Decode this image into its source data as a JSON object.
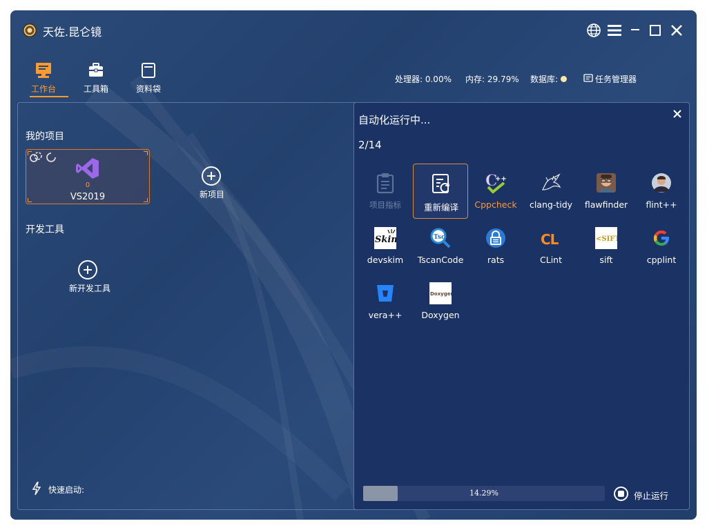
{
  "app": {
    "title": "天佐.昆仑镜"
  },
  "nav": {
    "tabs": [
      {
        "label": "工作台",
        "icon": "monitor-icon",
        "active": true
      },
      {
        "label": "工具箱",
        "icon": "toolbox-icon",
        "active": false
      },
      {
        "label": "资料袋",
        "icon": "folder-bag-icon",
        "active": false
      }
    ]
  },
  "status": {
    "cpu": "处理器: 0.00%",
    "memory": "内存: 29.79%",
    "database": "数据库:",
    "database_status_color": "#ffe9a8",
    "task_manager": "任务管理器"
  },
  "left": {
    "projects_title": "我的项目",
    "project": {
      "name": "VS2019",
      "count": "0"
    },
    "new_project": "新项目",
    "devtools_title": "开发工具",
    "new_devtool": "新开发工具",
    "quick_launch": "快速启动:"
  },
  "automation": {
    "title": "自动化运行中...",
    "counter": "2/14",
    "tools": [
      {
        "label": "项目指标",
        "icon": "clipboard-icon",
        "state": "disabled"
      },
      {
        "label": "重新编译",
        "icon": "recompile-icon",
        "state": "selected"
      },
      {
        "label": "Cppcheck",
        "icon": "cppcheck-icon",
        "state": "warn"
      },
      {
        "label": "clang-tidy",
        "icon": "dragon-icon",
        "state": "normal"
      },
      {
        "label": "flawfinder",
        "icon": "flawfinder-avatar-icon",
        "state": "normal"
      },
      {
        "label": "flint++",
        "icon": "flint-avatar-icon",
        "state": "normal"
      },
      {
        "label": "devskim",
        "icon": "devskim-icon",
        "state": "normal"
      },
      {
        "label": "TscanCode",
        "icon": "tscancode-icon",
        "state": "normal"
      },
      {
        "label": "rats",
        "icon": "rats-icon",
        "state": "normal"
      },
      {
        "label": "CLint",
        "icon": "clint-icon",
        "state": "normal"
      },
      {
        "label": "sift",
        "icon": "sift-icon",
        "state": "normal"
      },
      {
        "label": "cpplint",
        "icon": "google-icon",
        "state": "normal"
      },
      {
        "label": "vera++",
        "icon": "vera-icon",
        "state": "normal"
      },
      {
        "label": "Doxygen",
        "icon": "doxygen-icon",
        "state": "normal"
      }
    ],
    "progress_text": "14.29%",
    "progress_value": 0.1429,
    "stop_label": "停止运行"
  },
  "colors": {
    "accent": "#ff9a2e",
    "panel": "#1b3264",
    "background": "#24416e"
  }
}
